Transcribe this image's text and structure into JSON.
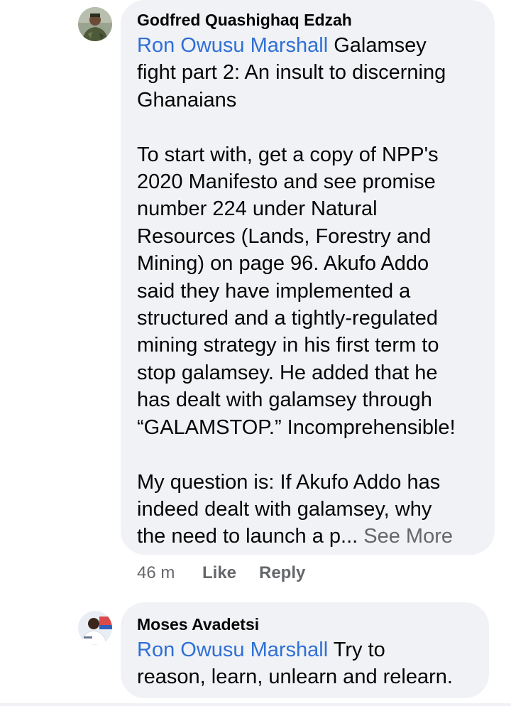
{
  "comments": [
    {
      "author": "Godfred Quashighaq Edzah",
      "mention": "Ron Owusu Marshall",
      "first_line_rest": " Galamsey",
      "body": "fight part 2: An insult to discerning\nGhanaians\n\nTo start with, get a copy of NPP's\n2020 Manifesto and see promise\nnumber 224 under Natural\nResources (Lands, Forestry and\nMining) on page 96. Akufo Addo\nsaid they have implemented a\nstructured and a tightly-regulated\nmining strategy in his first term to\nstop galamsey. He added that he\nhas dealt with galamsey through\n“GALAMSTOP.” Incomprehensible!\n\nMy question is: If Akufo Addo has\nindeed dealt with galamsey, why\nthe need to launch a p... ",
      "see_more": "See More",
      "time": "46 m",
      "like": "Like",
      "reply": "Reply"
    },
    {
      "author": "Moses Avadetsi",
      "mention": "Ron Owusu Marshall",
      "first_line_rest": " Try to",
      "body": "reason, learn, unlearn and relearn."
    }
  ],
  "colors": {
    "mention": "#2f6fd6",
    "bubble": "#f0f2f5",
    "meta": "#65676b"
  },
  "icons": {
    "avatar_1": "user-photo-military-uniform",
    "avatar_2": "user-photo-white-shirt"
  }
}
